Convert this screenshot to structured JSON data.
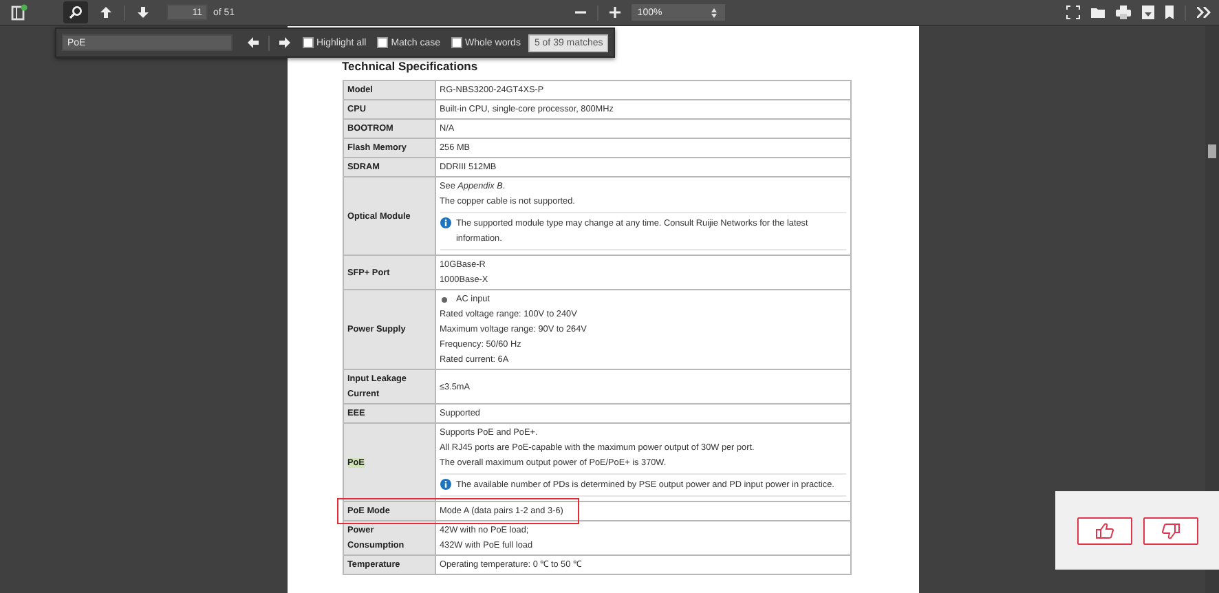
{
  "toolbar": {
    "page_number": "11",
    "page_count": "of 51",
    "zoom": "100%",
    "find_active": true
  },
  "find_bar": {
    "query": "PoE",
    "options": [
      {
        "label": "Highlight all",
        "checked": false
      },
      {
        "label": "Match case",
        "checked": false
      },
      {
        "label": "Whole words",
        "checked": false
      }
    ],
    "status": "5 of 39 matches"
  },
  "document": {
    "heading": "Technical Specifications",
    "rows": [
      {
        "label": "Model",
        "highlighted": false,
        "outlined": false,
        "items": [
          {
            "kind": "text",
            "text": "RG-NBS3200-24GT4XS-P"
          }
        ]
      },
      {
        "label": "CPU",
        "highlighted": false,
        "outlined": false,
        "items": [
          {
            "kind": "text",
            "text": "Built-in CPU, single-core processor, 800MHz"
          }
        ]
      },
      {
        "label": "BOOTROM",
        "highlighted": false,
        "outlined": false,
        "items": [
          {
            "kind": "text",
            "text": "N/A"
          }
        ]
      },
      {
        "label": "Flash Memory",
        "highlighted": false,
        "outlined": false,
        "items": [
          {
            "kind": "text",
            "text": "256 MB"
          }
        ]
      },
      {
        "label": "SDRAM",
        "highlighted": false,
        "outlined": false,
        "items": [
          {
            "kind": "text",
            "text": "DDRIII 512MB"
          }
        ]
      },
      {
        "label": "Optical Module",
        "highlighted": false,
        "outlined": false,
        "items": [
          {
            "kind": "text",
            "text": "See *Appendix B*."
          },
          {
            "kind": "text",
            "text": "The copper cable is not supported."
          },
          {
            "kind": "note",
            "text": "The supported module type may change at any time. Consult Ruijie Networks for the latest information."
          }
        ]
      },
      {
        "label": "SFP+ Port",
        "highlighted": false,
        "outlined": false,
        "items": [
          {
            "kind": "text",
            "text": "10GBase-R"
          },
          {
            "kind": "text",
            "text": "1000Base-X"
          }
        ]
      },
      {
        "label": "Power Supply",
        "highlighted": false,
        "outlined": false,
        "items": [
          {
            "kind": "bullet",
            "text": "AC input"
          },
          {
            "kind": "text",
            "text": "Rated voltage range: 100V to 240V"
          },
          {
            "kind": "text",
            "text": "Maximum voltage range: 90V to 264V"
          },
          {
            "kind": "text",
            "text": "Frequency: 50/60 Hz"
          },
          {
            "kind": "text",
            "text": "Rated current: 6A"
          }
        ]
      },
      {
        "label": "Input Leakage Current",
        "highlighted": false,
        "outlined": false,
        "items": [
          {
            "kind": "text",
            "text": "≤3.5mA"
          }
        ]
      },
      {
        "label": "EEE",
        "highlighted": false,
        "outlined": false,
        "items": [
          {
            "kind": "text",
            "text": "Supported"
          }
        ]
      },
      {
        "label": "PoE",
        "highlighted": true,
        "outlined": false,
        "items": [
          {
            "kind": "text",
            "text": "Supports PoE and PoE+."
          },
          {
            "kind": "text",
            "text": "All RJ45 ports are PoE-capable with the maximum power output of 30W per port."
          },
          {
            "kind": "text",
            "text": "The overall maximum output power of PoE/PoE+ is 370W."
          },
          {
            "kind": "note",
            "text": "The available number of PDs is determined by PSE output power and PD input power in practice."
          }
        ]
      },
      {
        "label": "PoE Mode",
        "highlighted": false,
        "outlined": true,
        "items": [
          {
            "kind": "text",
            "text": "Mode A (data pairs 1-2 and 3-6)"
          }
        ]
      },
      {
        "label": "Power Consumption",
        "highlighted": false,
        "outlined": false,
        "items": [
          {
            "kind": "text",
            "text": "42W with no PoE load;"
          },
          {
            "kind": "text",
            "text": "432W with PoE full load"
          }
        ]
      },
      {
        "label": "Temperature",
        "highlighted": false,
        "outlined": false,
        "items": [
          {
            "kind": "text",
            "text": "Operating temperature: 0 ℃ to 50 ℃"
          }
        ]
      }
    ]
  }
}
